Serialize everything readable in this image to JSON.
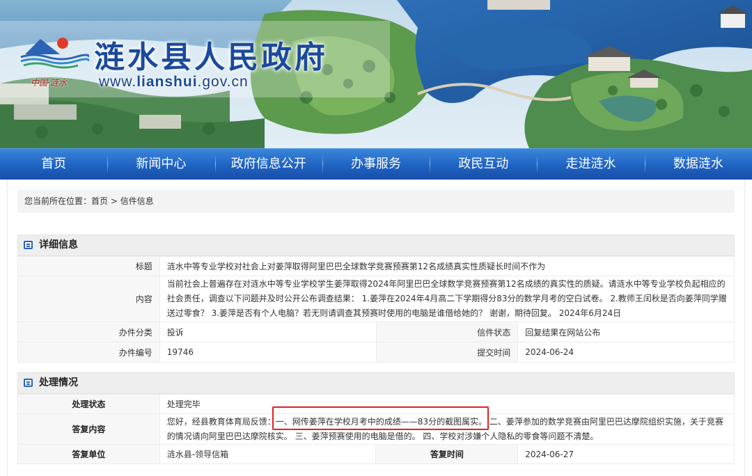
{
  "site": {
    "title": "涟水县人民政府",
    "url_prefix": "www.",
    "url_domain": "lianshui",
    "url_suffix": ".gov.cn",
    "slogan": "中国·涟水"
  },
  "nav": {
    "items": [
      "首页",
      "新闻中心",
      "政府信息公开",
      "办事服务",
      "政民互动",
      "走进涟水",
      "数据涟水"
    ]
  },
  "breadcrumb": {
    "prefix": "您当前所在位置：",
    "home": "首页",
    "sep": " > ",
    "current": "信件信息"
  },
  "detail": {
    "heading": "详细信息",
    "title_label": "标题",
    "title_value": "涟水中等专业学校对社会上对姜萍取得阿里巴巴全球数学竞赛预赛第12名成绩真实性质疑长时间不作为",
    "content_label": "内容",
    "content_value": "当前社会上普遍存在对涟水中等专业学校学生姜萍取得2024年阿里巴巴全球数学竞赛预赛第12名成绩的真实性的质疑。请涟水中等专业学校负起相应的社会责任，调查以下问题并及时公开公布调查结果： 1.姜萍在2024年4月高二下学期得分83分的数学月考的空白试卷。 2.教师王闰秋是否向姜萍同学赠送过零食？ 3.姜萍是否有个人电脑？若无则请调查其预赛时使用的电脑是谁借给她的？ 谢谢，期待回复。 2024年6月24日",
    "category_label": "办件分类",
    "category_value": "投诉",
    "status_label": "信件状态",
    "status_value": "回复结果在网站公布",
    "number_label": "办件编号",
    "number_value": "19746",
    "submit_label": "提交时间",
    "submit_value": "2024-06-24"
  },
  "handling": {
    "heading": "处理情况",
    "state_label": "处理状态",
    "state_value": "处理完毕",
    "reply_label": "答复内容",
    "reply_value": "您好，经县教育体育局反馈：一、网传姜萍在学校月考中的成绩——83分的截图属实。 二、姜萍参加的数学竞赛由阿里巴巴达摩院组织实施，关于竞赛的情况请向阿里巴巴达摩院核实。 三、姜萍预赛使用的电脑是借的。 四、学校对涉嫌个人隐私的零食等问题不清楚。",
    "unit_label": "答复单位",
    "unit_value": "涟水县-领导信箱",
    "time_label": "答复时间",
    "time_value": "2024-06-27"
  },
  "colors": {
    "nav": "#1f63c2",
    "title": "#1a4a9c",
    "highlight_box": "#e02020"
  }
}
